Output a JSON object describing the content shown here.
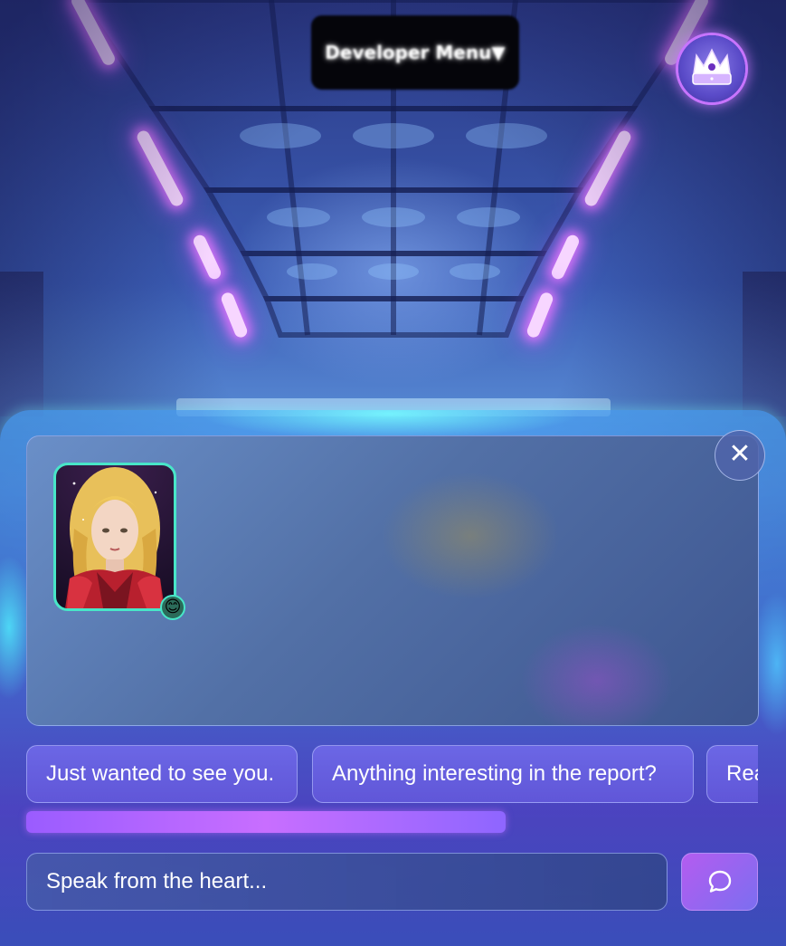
{
  "dev_menu": {
    "label": "Developer Menu▼"
  },
  "top_right": {
    "icon": "crown-icon"
  },
  "dialogue": {
    "close_icon": "close-icon",
    "close_glyph": "✕",
    "portrait": {
      "icon": "character-portrait",
      "frame_color": "#48e6c8"
    },
    "emotion_badge": {
      "glyph": "😊",
      "icon": "smiling-face-icon"
    }
  },
  "choices": [
    {
      "label": "Just wanted to see you."
    },
    {
      "label": "Anything interesting in the report?"
    },
    {
      "label": "Rea"
    }
  ],
  "choices_scroll": {
    "thumb_fraction": 0.655
  },
  "input": {
    "placeholder": "Speak from the heart...",
    "value": ""
  },
  "send": {
    "icon": "speech-bubble-icon"
  },
  "colors": {
    "accent_purple": "#b45cf0",
    "glow_cyan": "#48e6c8",
    "light_strip": "#f7d6ff"
  }
}
